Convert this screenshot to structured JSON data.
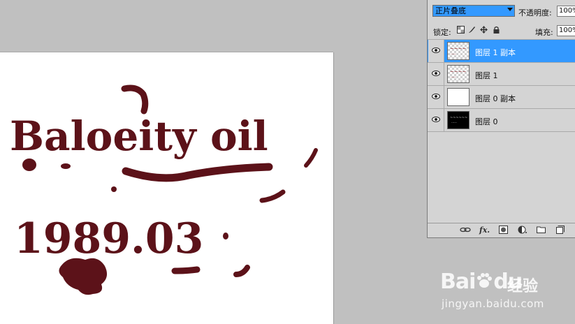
{
  "canvas": {
    "line1": "Baloeity oil",
    "line2": "1989.03",
    "ink_color": "#5c1219"
  },
  "layers_panel": {
    "blend_mode": "正片叠底",
    "opacity_label": "不透明度:",
    "opacity_value": "100%",
    "lock_label": "锁定:",
    "fill_label": "填充:",
    "fill_value": "100%",
    "selection_color": "#3399ff",
    "layers": [
      {
        "name": "图层 1 副本",
        "selected": true,
        "thumb": "checker-text"
      },
      {
        "name": "图层 1",
        "selected": false,
        "thumb": "checker-text"
      },
      {
        "name": "图层 0 副本",
        "selected": false,
        "thumb": "white"
      },
      {
        "name": "图层 0",
        "selected": false,
        "thumb": "dark-text"
      }
    ],
    "footer_icons": [
      "link-icon",
      "fx-icon",
      "mask-icon",
      "adjustment-icon",
      "folder-icon",
      "new-layer-icon"
    ]
  },
  "watermark": {
    "brand": "Bai",
    "brand_suffix": "du",
    "product": "经验",
    "url": "jingyan.baidu.com"
  }
}
